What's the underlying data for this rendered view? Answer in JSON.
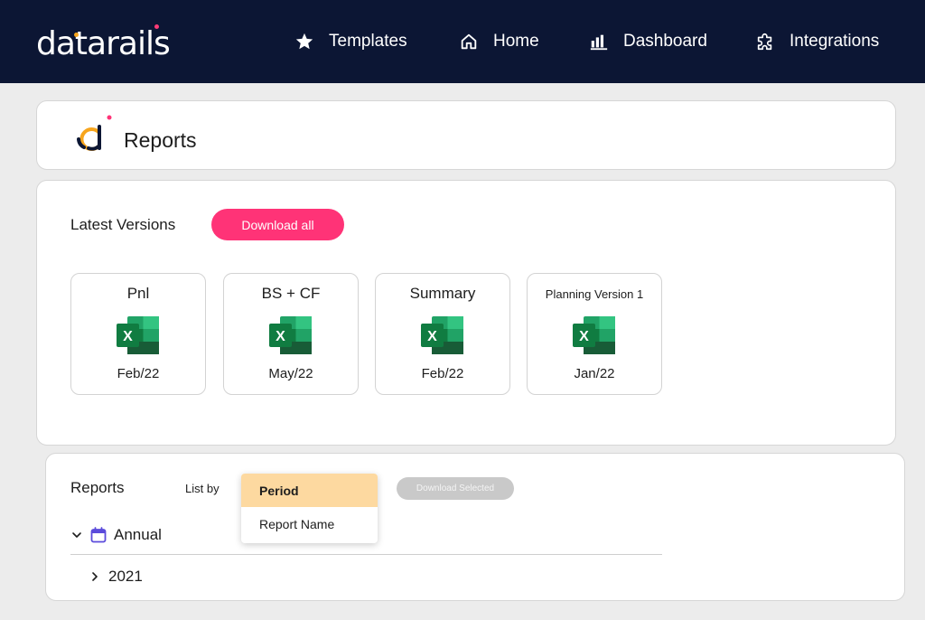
{
  "header": {
    "brand": "datarails",
    "nav": [
      {
        "label": "Templates",
        "icon": "star-icon"
      },
      {
        "label": "Home",
        "icon": "home-icon"
      },
      {
        "label": "Dashboard",
        "icon": "bar-chart-icon"
      },
      {
        "label": "Integrations",
        "icon": "puzzle-icon"
      }
    ]
  },
  "page": {
    "title": "Reports"
  },
  "latest": {
    "title": "Latest Versions",
    "download_all_label": "Download all",
    "files": [
      {
        "name": "Pnl",
        "date": "Feb/22",
        "icon": "excel-icon"
      },
      {
        "name": "BS + CF",
        "date": "May/22",
        "icon": "excel-icon"
      },
      {
        "name": "Summary",
        "date": "Feb/22",
        "icon": "excel-icon"
      },
      {
        "name": "Planning Version 1",
        "date": "Jan/22",
        "icon": "excel-icon"
      }
    ]
  },
  "reports": {
    "title": "Reports",
    "list_by_label": "List by",
    "list_by_options": [
      "Period",
      "Report Name"
    ],
    "list_by_selected": "Period",
    "download_selected_label": "Download Selected",
    "tree": [
      {
        "label": "Annual",
        "expanded": true,
        "icon": "calendar-icon",
        "children": [
          {
            "label": "2021",
            "expanded": false
          }
        ]
      }
    ]
  },
  "colors": {
    "topbar": "#0c1634",
    "accent_pink": "#ff3377",
    "selected_option": "#fdd9a0",
    "excel_green": "#1f7a45",
    "calendar_icon": "#5b4bdb"
  }
}
